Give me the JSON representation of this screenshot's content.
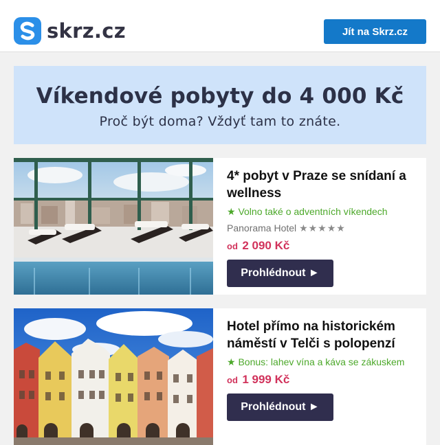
{
  "header": {
    "logo_text": "skrz.cz",
    "cta_label": "Jít na Skrz.cz"
  },
  "hero": {
    "title": "Víkendové pobyty do 4 000 Kč",
    "subtitle": "Proč být doma? Vždyť tam to znáte."
  },
  "offers": [
    {
      "title": "4* pobyt v Praze se snídaní a wellness",
      "note": "★ Volno také o adventních víkendech",
      "hotel": "Panorama Hotel",
      "stars": "★★★★★",
      "price_prefix": "od",
      "price": "2 090 Kč",
      "button": "Prohlédnout ►",
      "image": "pool-panorama"
    },
    {
      "title": "Hotel přímo na historickém náměstí v Telči s polopenzí",
      "note": "★ Bonus: lahev vína a káva se zákuskem",
      "price_prefix": "od",
      "price": "1 999 Kč",
      "button": "Prohlédnout ►",
      "image": "telc-square-houses"
    }
  ],
  "colors": {
    "brand": "#2b8fe8",
    "cta": "#1479c9",
    "hero_bg": "#cfe3fa",
    "note_green": "#4ca82a",
    "price_red": "#d1325b",
    "button_dark": "#302e4e"
  }
}
